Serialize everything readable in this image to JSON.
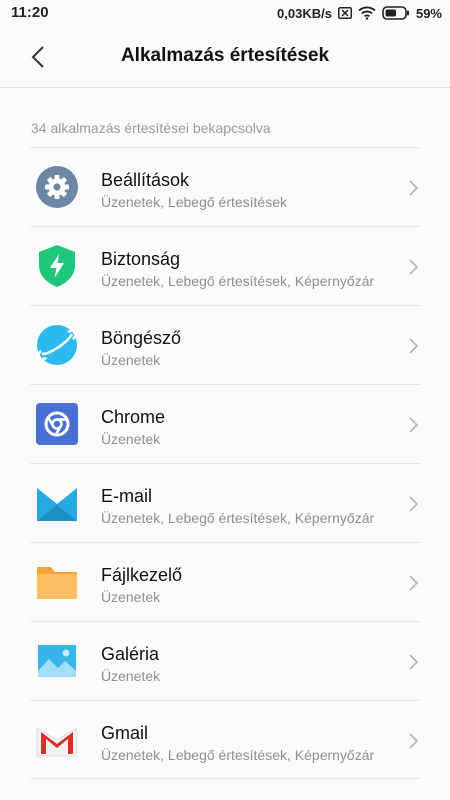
{
  "statusbar": {
    "time": "11:20",
    "speed": "0,03KB/s",
    "battery": "59%",
    "battery_level": 0.59
  },
  "header": {
    "title": "Alkalmazás értesítések",
    "back_icon": "chevron-left-icon"
  },
  "section_label": "34 alkalmazás értesítései bekapcsolva",
  "apps": [
    {
      "name": "Beállítások",
      "sub": "Üzenetek, Lebegő értesítések",
      "icon": "settings-gear-icon"
    },
    {
      "name": "Biztonság",
      "sub": "Üzenetek, Lebegő értesítések, Képernyőzár",
      "icon": "security-shield-icon"
    },
    {
      "name": "Böngésző",
      "sub": "Üzenetek",
      "icon": "browser-planet-icon"
    },
    {
      "name": "Chrome",
      "sub": "Üzenetek",
      "icon": "chrome-icon"
    },
    {
      "name": "E-mail",
      "sub": "Üzenetek, Lebegő értesítések, Képernyőzár",
      "icon": "email-envelope-icon"
    },
    {
      "name": "Fájlkezelő",
      "sub": "Üzenetek",
      "icon": "file-manager-folder-icon"
    },
    {
      "name": "Galéria",
      "sub": "Üzenetek",
      "icon": "gallery-icon"
    },
    {
      "name": "Gmail",
      "sub": "Üzenetek, Lebegő értesítések, Képernyőzár",
      "icon": "gmail-icon"
    }
  ],
  "colors": {
    "settings": "#6b87a5",
    "security": "#1fc77d",
    "browser": "#2bb9ee",
    "chrome_bg": "#4a6fd3",
    "email": "#27a8e0",
    "folder": "#fbb95a",
    "gallery": "#37b5e8",
    "gmail_red": "#d93025"
  }
}
